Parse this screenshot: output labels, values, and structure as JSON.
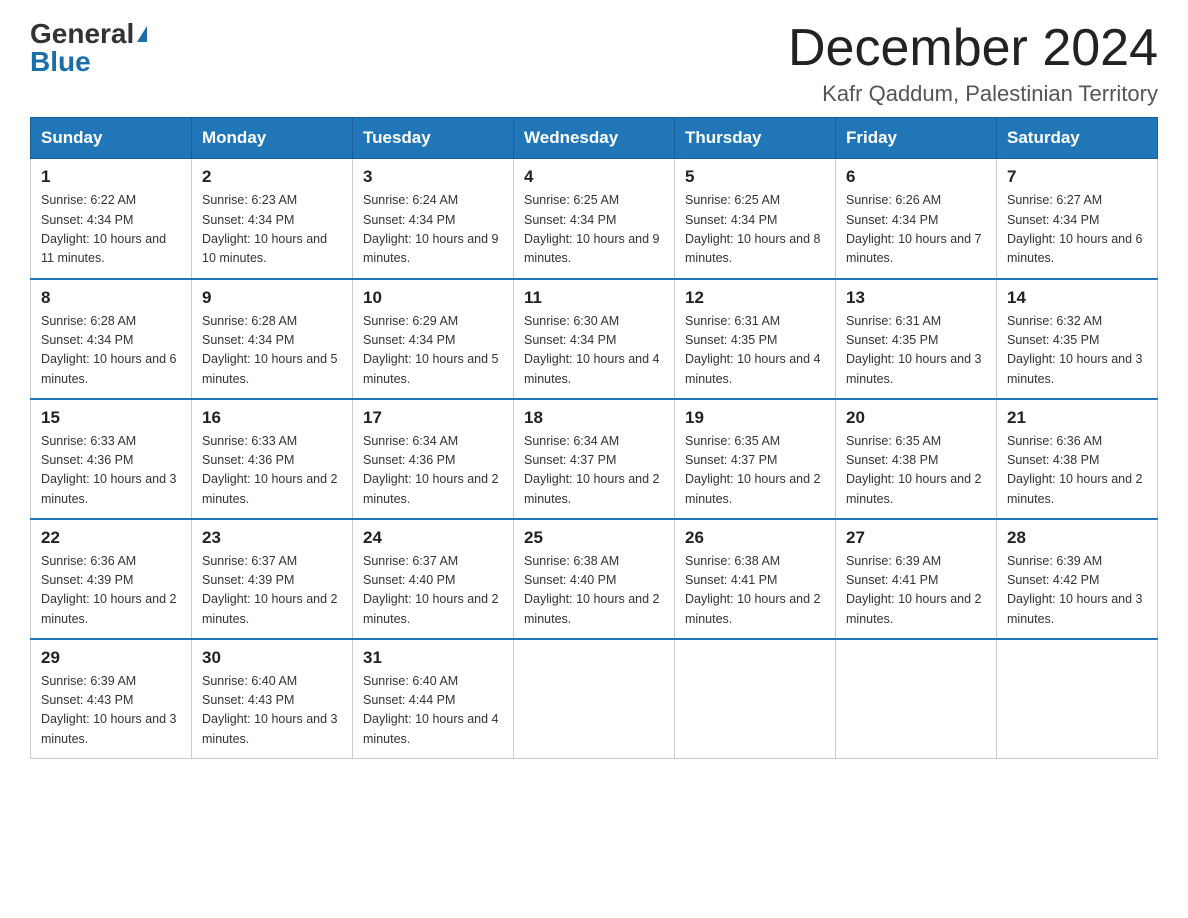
{
  "logo": {
    "general": "General",
    "blue": "Blue"
  },
  "header": {
    "month": "December 2024",
    "location": "Kafr Qaddum, Palestinian Territory"
  },
  "weekdays": [
    "Sunday",
    "Monday",
    "Tuesday",
    "Wednesday",
    "Thursday",
    "Friday",
    "Saturday"
  ],
  "weeks": [
    [
      {
        "day": "1",
        "sunrise": "6:22 AM",
        "sunset": "4:34 PM",
        "daylight": "10 hours and 11 minutes."
      },
      {
        "day": "2",
        "sunrise": "6:23 AM",
        "sunset": "4:34 PM",
        "daylight": "10 hours and 10 minutes."
      },
      {
        "day": "3",
        "sunrise": "6:24 AM",
        "sunset": "4:34 PM",
        "daylight": "10 hours and 9 minutes."
      },
      {
        "day": "4",
        "sunrise": "6:25 AM",
        "sunset": "4:34 PM",
        "daylight": "10 hours and 9 minutes."
      },
      {
        "day": "5",
        "sunrise": "6:25 AM",
        "sunset": "4:34 PM",
        "daylight": "10 hours and 8 minutes."
      },
      {
        "day": "6",
        "sunrise": "6:26 AM",
        "sunset": "4:34 PM",
        "daylight": "10 hours and 7 minutes."
      },
      {
        "day": "7",
        "sunrise": "6:27 AM",
        "sunset": "4:34 PM",
        "daylight": "10 hours and 6 minutes."
      }
    ],
    [
      {
        "day": "8",
        "sunrise": "6:28 AM",
        "sunset": "4:34 PM",
        "daylight": "10 hours and 6 minutes."
      },
      {
        "day": "9",
        "sunrise": "6:28 AM",
        "sunset": "4:34 PM",
        "daylight": "10 hours and 5 minutes."
      },
      {
        "day": "10",
        "sunrise": "6:29 AM",
        "sunset": "4:34 PM",
        "daylight": "10 hours and 5 minutes."
      },
      {
        "day": "11",
        "sunrise": "6:30 AM",
        "sunset": "4:34 PM",
        "daylight": "10 hours and 4 minutes."
      },
      {
        "day": "12",
        "sunrise": "6:31 AM",
        "sunset": "4:35 PM",
        "daylight": "10 hours and 4 minutes."
      },
      {
        "day": "13",
        "sunrise": "6:31 AM",
        "sunset": "4:35 PM",
        "daylight": "10 hours and 3 minutes."
      },
      {
        "day": "14",
        "sunrise": "6:32 AM",
        "sunset": "4:35 PM",
        "daylight": "10 hours and 3 minutes."
      }
    ],
    [
      {
        "day": "15",
        "sunrise": "6:33 AM",
        "sunset": "4:36 PM",
        "daylight": "10 hours and 3 minutes."
      },
      {
        "day": "16",
        "sunrise": "6:33 AM",
        "sunset": "4:36 PM",
        "daylight": "10 hours and 2 minutes."
      },
      {
        "day": "17",
        "sunrise": "6:34 AM",
        "sunset": "4:36 PM",
        "daylight": "10 hours and 2 minutes."
      },
      {
        "day": "18",
        "sunrise": "6:34 AM",
        "sunset": "4:37 PM",
        "daylight": "10 hours and 2 minutes."
      },
      {
        "day": "19",
        "sunrise": "6:35 AM",
        "sunset": "4:37 PM",
        "daylight": "10 hours and 2 minutes."
      },
      {
        "day": "20",
        "sunrise": "6:35 AM",
        "sunset": "4:38 PM",
        "daylight": "10 hours and 2 minutes."
      },
      {
        "day": "21",
        "sunrise": "6:36 AM",
        "sunset": "4:38 PM",
        "daylight": "10 hours and 2 minutes."
      }
    ],
    [
      {
        "day": "22",
        "sunrise": "6:36 AM",
        "sunset": "4:39 PM",
        "daylight": "10 hours and 2 minutes."
      },
      {
        "day": "23",
        "sunrise": "6:37 AM",
        "sunset": "4:39 PM",
        "daylight": "10 hours and 2 minutes."
      },
      {
        "day": "24",
        "sunrise": "6:37 AM",
        "sunset": "4:40 PM",
        "daylight": "10 hours and 2 minutes."
      },
      {
        "day": "25",
        "sunrise": "6:38 AM",
        "sunset": "4:40 PM",
        "daylight": "10 hours and 2 minutes."
      },
      {
        "day": "26",
        "sunrise": "6:38 AM",
        "sunset": "4:41 PM",
        "daylight": "10 hours and 2 minutes."
      },
      {
        "day": "27",
        "sunrise": "6:39 AM",
        "sunset": "4:41 PM",
        "daylight": "10 hours and 2 minutes."
      },
      {
        "day": "28",
        "sunrise": "6:39 AM",
        "sunset": "4:42 PM",
        "daylight": "10 hours and 3 minutes."
      }
    ],
    [
      {
        "day": "29",
        "sunrise": "6:39 AM",
        "sunset": "4:43 PM",
        "daylight": "10 hours and 3 minutes."
      },
      {
        "day": "30",
        "sunrise": "6:40 AM",
        "sunset": "4:43 PM",
        "daylight": "10 hours and 3 minutes."
      },
      {
        "day": "31",
        "sunrise": "6:40 AM",
        "sunset": "4:44 PM",
        "daylight": "10 hours and 4 minutes."
      },
      null,
      null,
      null,
      null
    ]
  ]
}
